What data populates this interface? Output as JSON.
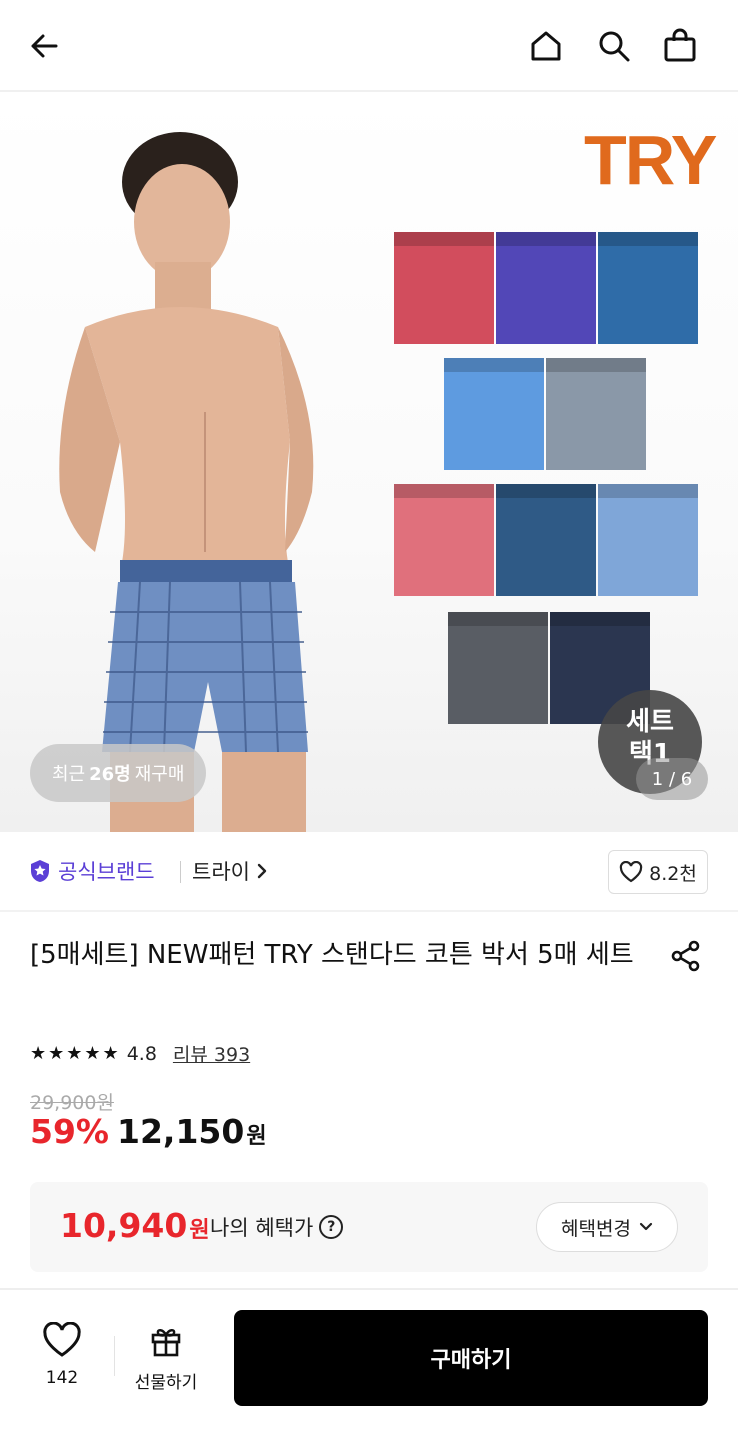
{
  "header": {
    "icons": [
      "back-arrow-icon",
      "home-icon",
      "search-icon",
      "shopping-bag-icon"
    ]
  },
  "hero": {
    "brand_logo": "TRY",
    "reorder": {
      "prefix": "최근",
      "count": "26명",
      "suffix": "재구매"
    },
    "set_badge": {
      "line1": "세트",
      "line2": "택1"
    },
    "page_indicator": "1 / 6"
  },
  "brand": {
    "official_label": "공식브랜드",
    "name": "트라이",
    "likes": "8.2천"
  },
  "product": {
    "title": "[5매세트] NEW패턴 TRY 스탠다드 코튼 박서 5매 세트",
    "rating": "4.8",
    "review_label": "리뷰 393",
    "original_price": "29,900원",
    "discount": "59%",
    "price": "12,150",
    "price_unit": "원"
  },
  "benefit": {
    "price": "10,940",
    "unit": "원",
    "label": "나의 혜택가",
    "button": "혜택변경"
  },
  "bottom": {
    "wish_count": "142",
    "gift_label": "선물하기",
    "buy_label": "구매하기"
  },
  "colors": {
    "accent_red": "#e8262c",
    "official_purple": "#5b3fd6",
    "brand_orange": "#e06a1d"
  }
}
